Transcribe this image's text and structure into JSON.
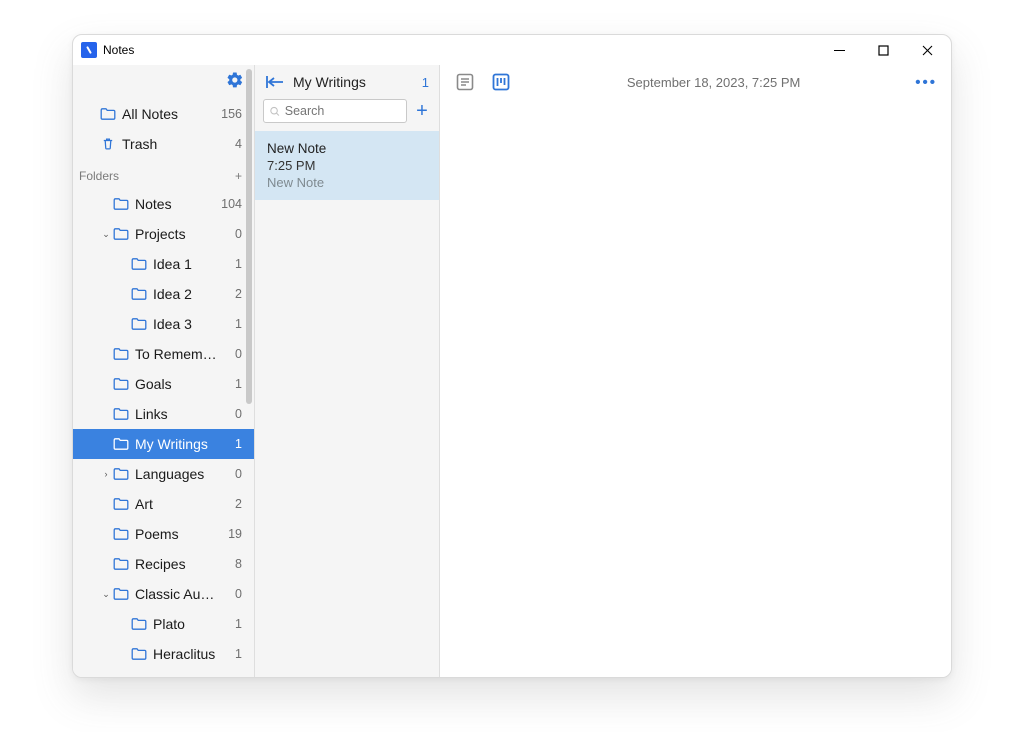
{
  "window": {
    "title": "Notes"
  },
  "sidebar": {
    "all_notes": {
      "label": "All Notes",
      "count": 156
    },
    "trash": {
      "label": "Trash",
      "count": 4
    },
    "folders_header": "Folders",
    "folders": [
      {
        "label": "Notes",
        "count": 104,
        "indent": 1,
        "expand": null
      },
      {
        "label": "Projects",
        "count": 0,
        "indent": 1,
        "expand": "open"
      },
      {
        "label": "Idea 1",
        "count": 1,
        "indent": 2,
        "expand": null
      },
      {
        "label": "Idea 2",
        "count": 2,
        "indent": 2,
        "expand": null
      },
      {
        "label": "Idea 3",
        "count": 1,
        "indent": 2,
        "expand": null
      },
      {
        "label": "To Remem…",
        "count": 0,
        "indent": 1,
        "expand": null
      },
      {
        "label": "Goals",
        "count": 1,
        "indent": 1,
        "expand": null
      },
      {
        "label": "Links",
        "count": 0,
        "indent": 1,
        "expand": null
      },
      {
        "label": "My Writings",
        "count": 1,
        "indent": 1,
        "expand": null,
        "selected": true
      },
      {
        "label": "Languages",
        "count": 0,
        "indent": 1,
        "expand": "closed"
      },
      {
        "label": "Art",
        "count": 2,
        "indent": 1,
        "expand": null
      },
      {
        "label": "Poems",
        "count": 19,
        "indent": 1,
        "expand": null
      },
      {
        "label": "Recipes",
        "count": 8,
        "indent": 1,
        "expand": null
      },
      {
        "label": "Classic Aut…",
        "count": 0,
        "indent": 1,
        "expand": "open"
      },
      {
        "label": "Plato",
        "count": 1,
        "indent": 2,
        "expand": null
      },
      {
        "label": "Heraclitus",
        "count": 1,
        "indent": 2,
        "expand": null
      }
    ]
  },
  "notelist": {
    "title": "My Writings",
    "count": 1,
    "search_placeholder": "Search",
    "notes": [
      {
        "title": "New Note",
        "time": "7:25 PM",
        "preview": "New Note"
      }
    ]
  },
  "editor": {
    "timestamp": "September 18, 2023, 7:25 PM"
  }
}
